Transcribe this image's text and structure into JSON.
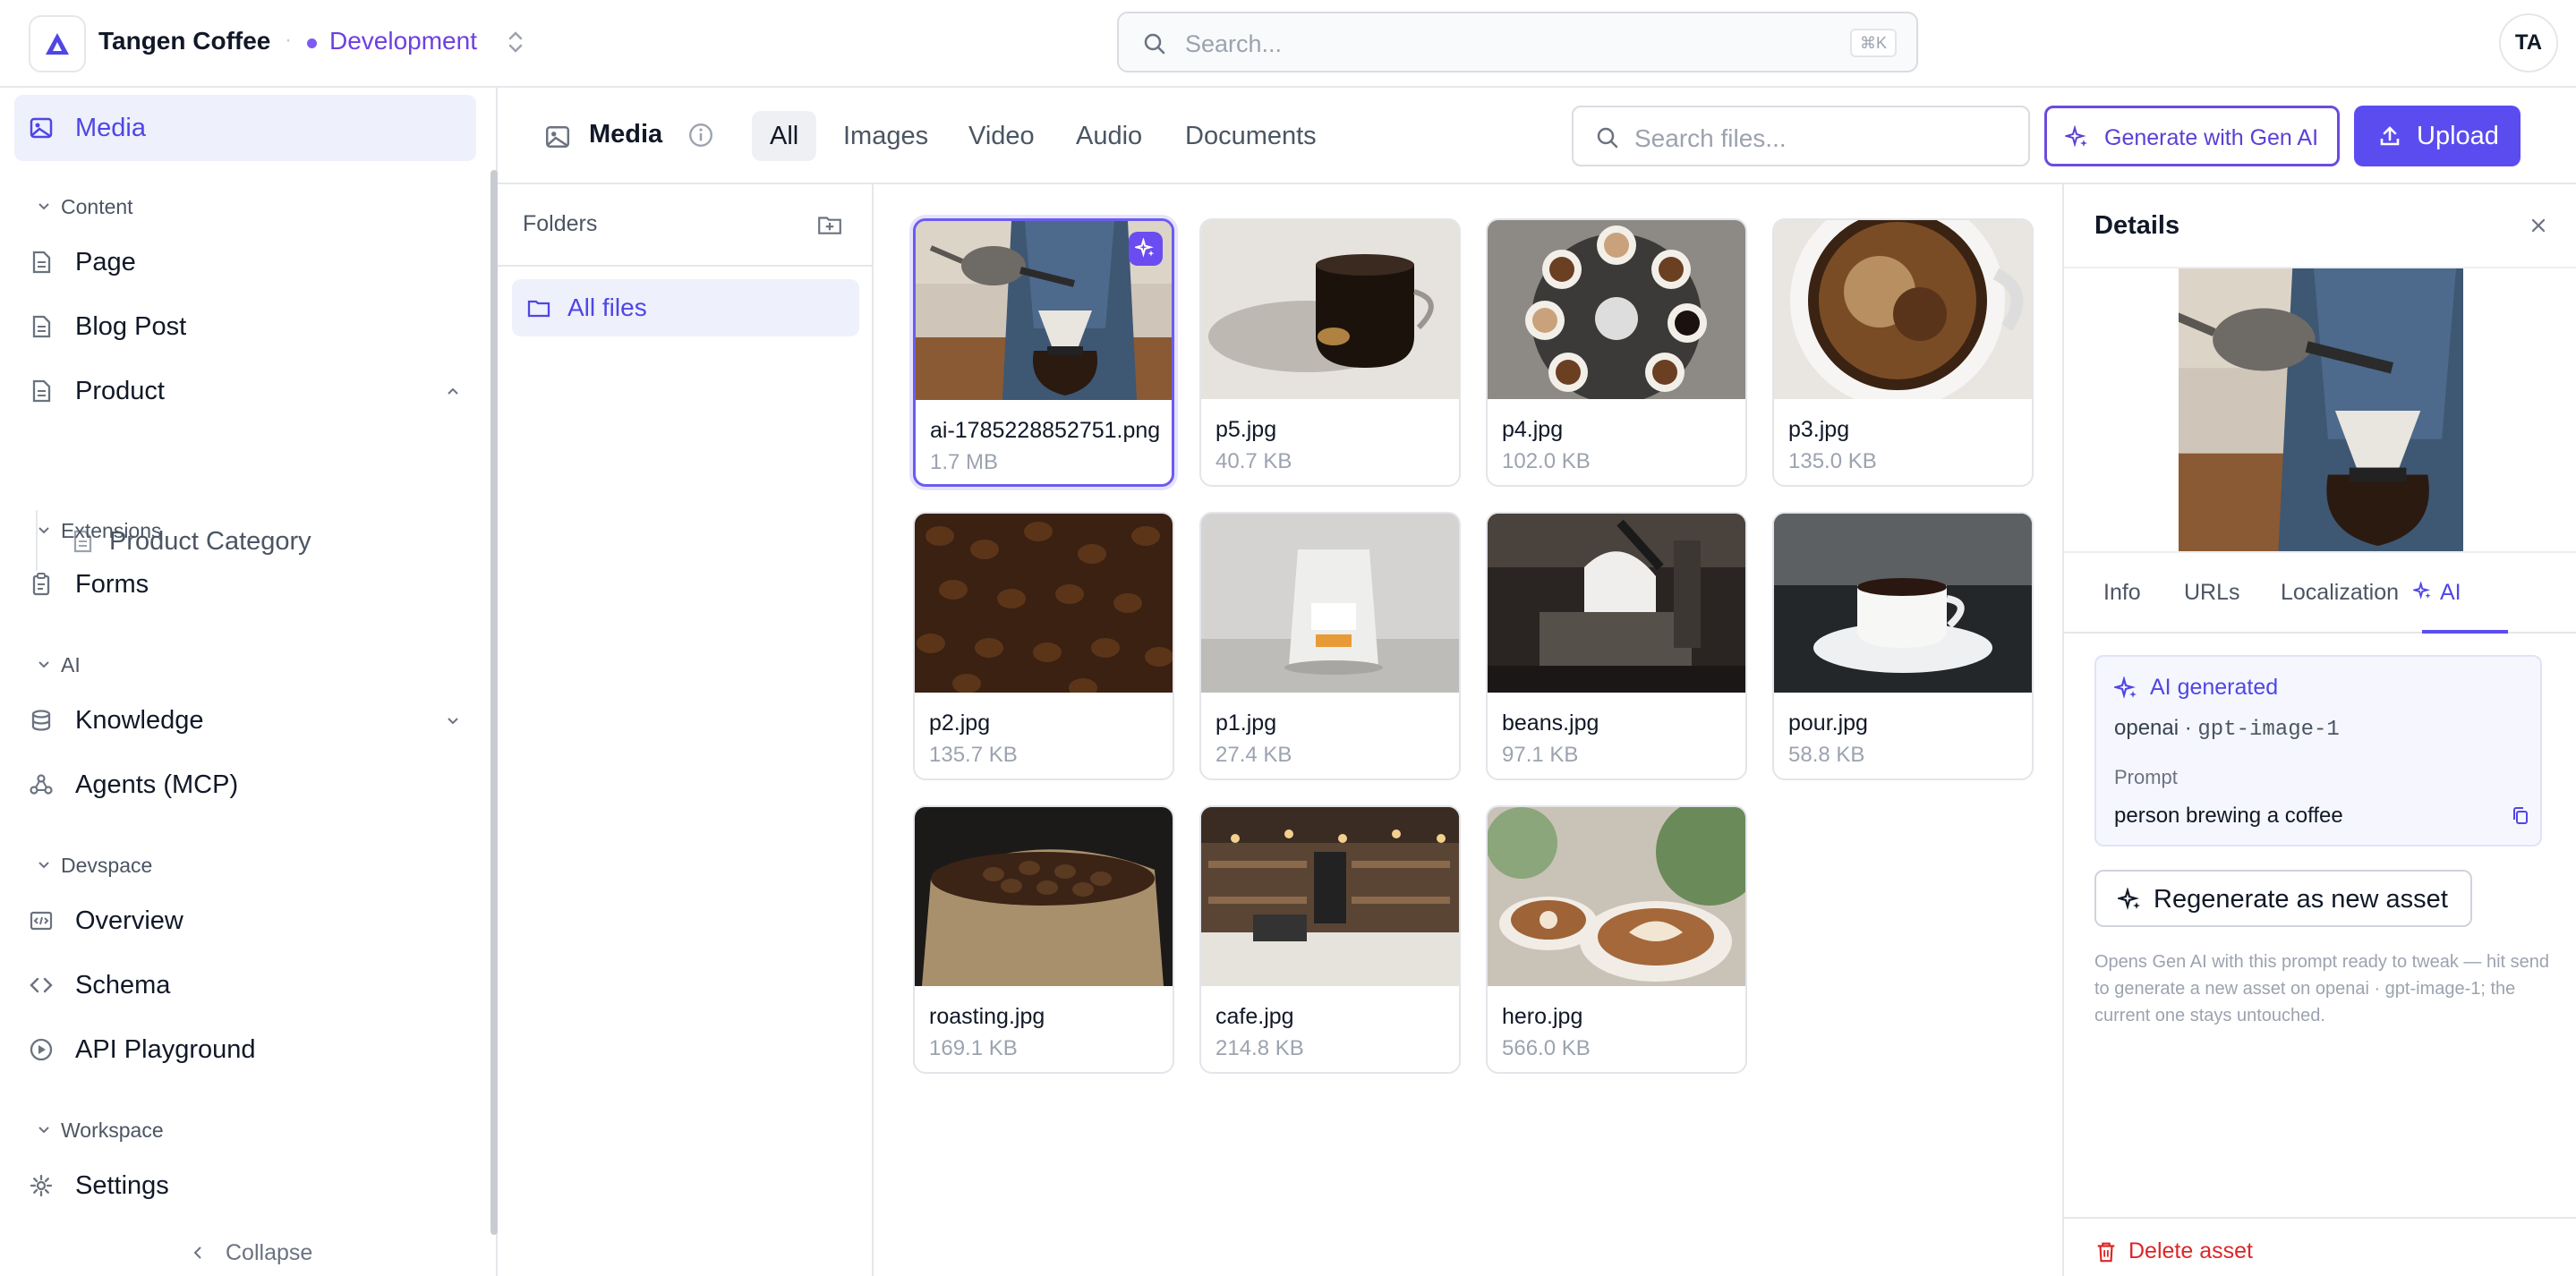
{
  "topbar": {
    "brand": "Tangen Coffee",
    "env_separator": "·",
    "environment": "Development",
    "search_placeholder": "Search...",
    "search_shortcut": "⌘K",
    "avatar_initials": "TA"
  },
  "sidebar": {
    "media": "Media",
    "sections": {
      "content": "Content",
      "extensions": "Extensions",
      "ai": "AI",
      "devspace": "Devspace",
      "workspace": "Workspace"
    },
    "items": {
      "page": "Page",
      "blog_post": "Blog Post",
      "product": "Product",
      "product_category": "Product Category",
      "forms": "Forms",
      "knowledge": "Knowledge",
      "agents": "Agents (MCP)",
      "overview": "Overview",
      "schema": "Schema",
      "api_playground": "API Playground",
      "settings": "Settings"
    },
    "collapse": "Collapse"
  },
  "main": {
    "title": "Media",
    "tabs": [
      "All",
      "Images",
      "Video",
      "Audio",
      "Documents"
    ],
    "active_tab": "All",
    "search_placeholder": "Search files...",
    "generate_label": "Generate with Gen AI",
    "upload_label": "Upload"
  },
  "folders": {
    "title": "Folders",
    "items": [
      "All files"
    ]
  },
  "files": [
    {
      "name": "ai-1785228852751.png",
      "size": "1.7 MB",
      "selected": true,
      "ai": true,
      "thumb": "brewing"
    },
    {
      "name": "p5.jpg",
      "size": "40.7 KB",
      "thumb": "cup-glass"
    },
    {
      "name": "p4.jpg",
      "size": "102.0 KB",
      "thumb": "cups-top"
    },
    {
      "name": "p3.jpg",
      "size": "135.0 KB",
      "thumb": "crema"
    },
    {
      "name": "p2.jpg",
      "size": "135.7 KB",
      "thumb": "beans"
    },
    {
      "name": "p1.jpg",
      "size": "27.4 KB",
      "thumb": "bag"
    },
    {
      "name": "beans.jpg",
      "size": "97.1 KB",
      "thumb": "barista"
    },
    {
      "name": "pour.jpg",
      "size": "58.8 KB",
      "thumb": "white-cup"
    },
    {
      "name": "roasting.jpg",
      "size": "169.1 KB",
      "thumb": "sack"
    },
    {
      "name": "cafe.jpg",
      "size": "214.8 KB",
      "thumb": "cafe"
    },
    {
      "name": "hero.jpg",
      "size": "566.0 KB",
      "thumb": "latte"
    }
  ],
  "details": {
    "title": "Details",
    "tabs": [
      "Info",
      "URLs",
      "Localization",
      "AI"
    ],
    "active_tab": "AI",
    "ai_generated": "AI generated",
    "provider": "openai",
    "model_sep": " · ",
    "model": "gpt-image-1",
    "prompt_label": "Prompt",
    "prompt": "person brewing a coffee",
    "regenerate": "Regenerate as new asset",
    "help": "Opens Gen AI with this prompt ready to tweak — hit send to generate a new asset on openai · gpt-image-1; the current one stays untouched.",
    "delete": "Delete asset"
  },
  "colors": {
    "accent": "#5b4cf0",
    "accent_text": "#4f46e5",
    "danger": "#dc2626"
  }
}
